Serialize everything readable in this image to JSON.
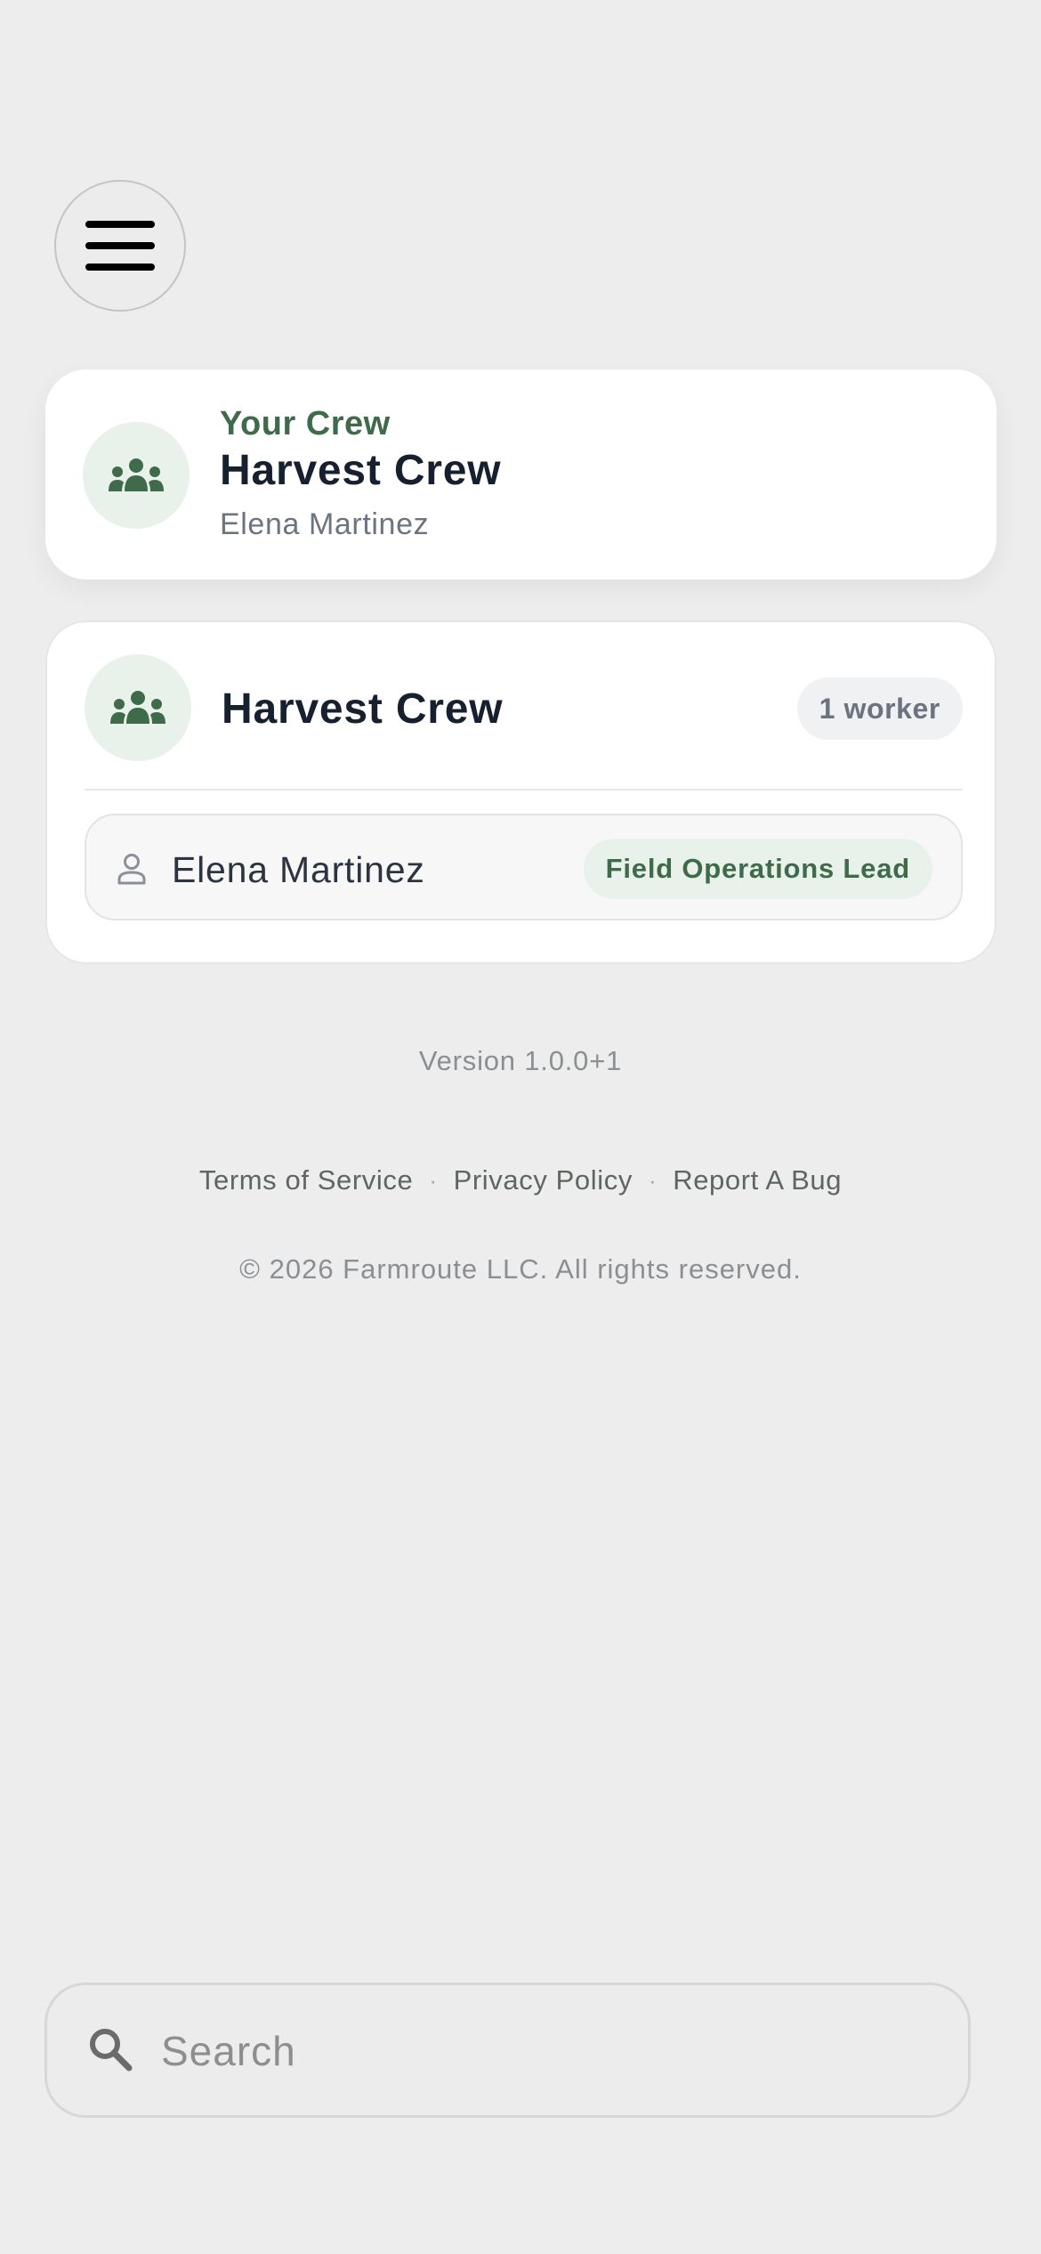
{
  "menu": {
    "icon": "hamburger-menu-icon"
  },
  "crew_summary": {
    "eyebrow": "Your Crew",
    "title": "Harvest Crew",
    "subtitle": "Elena Martinez",
    "icon": "group-icon"
  },
  "crew_detail": {
    "title": "Harvest Crew",
    "count_label": "1 worker",
    "icon": "group-icon",
    "members": [
      {
        "name": "Elena Martinez",
        "role": "Field Operations Lead",
        "icon": "person-icon"
      }
    ]
  },
  "footer": {
    "version": "Version 1.0.0+1",
    "links": [
      "Terms of Service",
      "Privacy Policy",
      "Report A Bug"
    ],
    "separator": "·",
    "copyright": "© 2026 Farmroute LLC. All rights reserved."
  },
  "search": {
    "placeholder": "Search",
    "value": "",
    "icon": "search-icon"
  },
  "colors": {
    "background": "#ededed",
    "accent_green": "#3f6b4a",
    "avatar_bg": "#e8f1ea",
    "title_text": "#17202e"
  }
}
